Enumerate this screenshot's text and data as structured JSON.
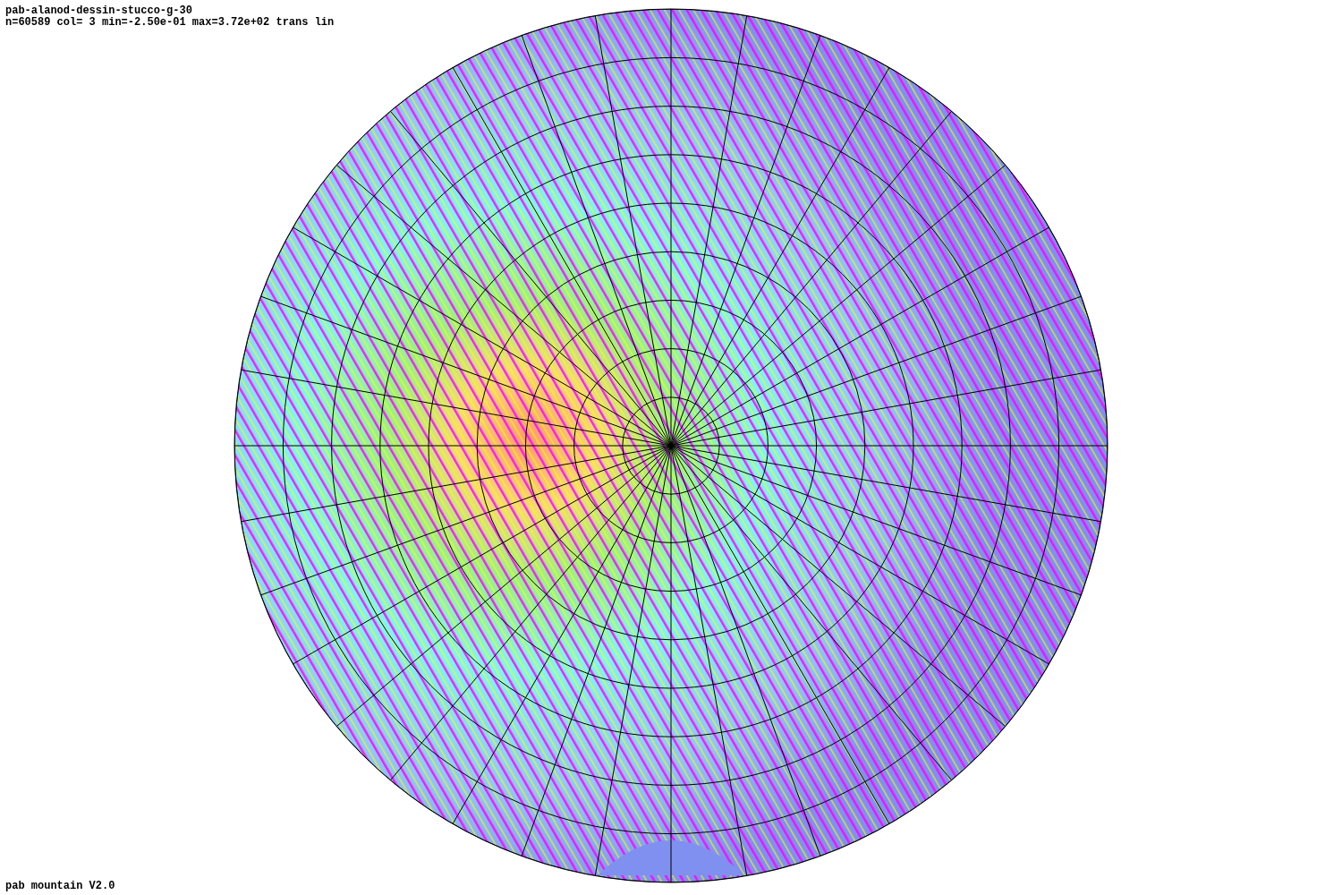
{
  "header": {
    "title": "pab-alanod-dessin-stucco-g-30",
    "stats": "n=60589 col= 3 min=-2.50e-01 max=3.72e+02 trans lin"
  },
  "footer": {
    "version": "pab mountain V2.0"
  }
}
